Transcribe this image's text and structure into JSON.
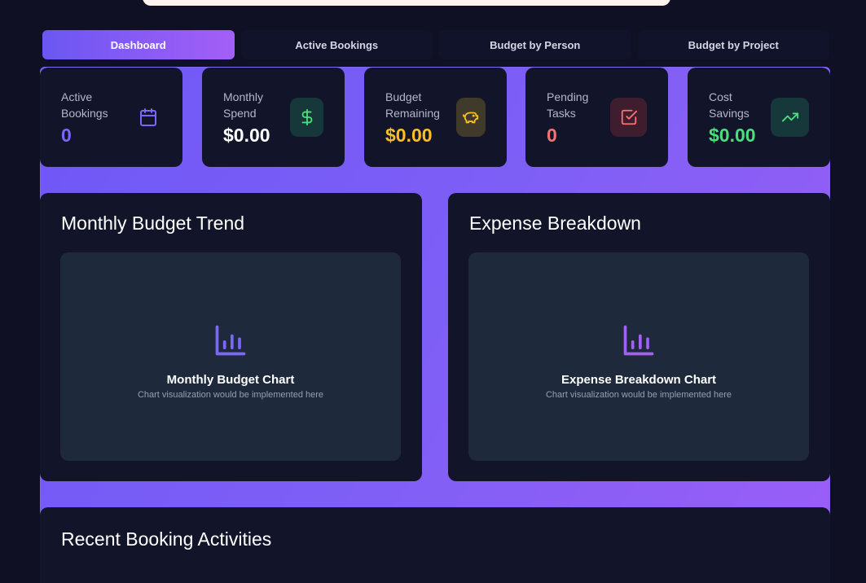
{
  "tabs": [
    {
      "label": "Dashboard",
      "active": true
    },
    {
      "label": "Active Bookings",
      "active": false
    },
    {
      "label": "Budget by Person",
      "active": false
    },
    {
      "label": "Budget by Project",
      "active": false
    }
  ],
  "stats": [
    {
      "label": "Active Bookings",
      "value": "0",
      "value_color": "#7b66ff",
      "icon": "calendar-icon"
    },
    {
      "label": "Monthly Spend",
      "value": "$0.00",
      "value_color": "#ffffff",
      "icon": "dollar-icon"
    },
    {
      "label": "Budget Remaining",
      "value": "$0.00",
      "value_color": "#fbbf24",
      "icon": "piggy-bank-icon"
    },
    {
      "label": "Pending Tasks",
      "value": "0",
      "value_color": "#f87171",
      "icon": "check-square-icon"
    },
    {
      "label": "Cost Savings",
      "value": "$0.00",
      "value_color": "#4ade80",
      "icon": "trending-up-icon"
    }
  ],
  "cards": {
    "budget_trend": {
      "title": "Monthly Budget Trend",
      "chart_name": "Monthly Budget Chart",
      "chart_note": "Chart visualization would be implemented here"
    },
    "expense": {
      "title": "Expense Breakdown",
      "chart_name": "Expense Breakdown Chart",
      "chart_note": "Chart visualization would be implemented here"
    },
    "recent": {
      "title": "Recent Booking Activities"
    }
  },
  "colors": {
    "accent_start": "#6b57f2",
    "accent_end": "#a35ff6",
    "panel_bg": "#121429",
    "chart_bg": "#1e293b"
  }
}
